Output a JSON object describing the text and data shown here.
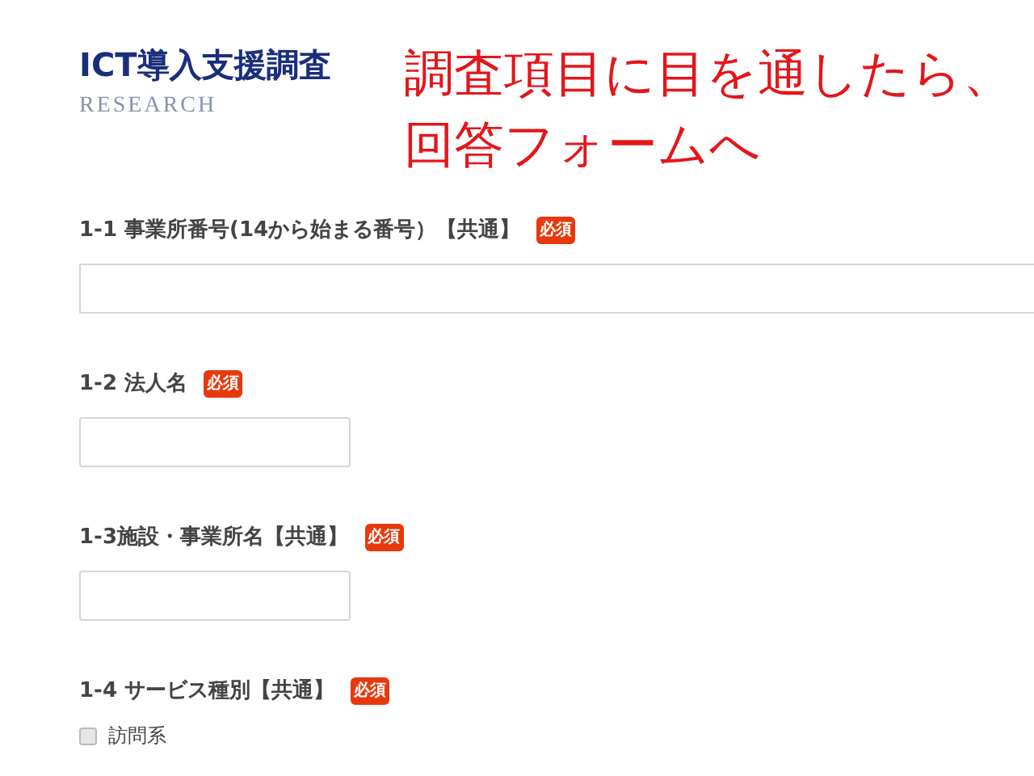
{
  "brand": {
    "title": "ICT導入支援調査",
    "subtitle": "RESEARCH"
  },
  "annotation": {
    "lines": [
      "調査項目に目を通したら、",
      "回答フォームへ"
    ]
  },
  "questions": [
    {
      "kind": "text-wide",
      "label": "1-1 事業所番号(14から始まる番号）【共通】",
      "badge": "必須"
    },
    {
      "kind": "text",
      "label": "1-2 法人名",
      "badge": "必須"
    },
    {
      "kind": "text",
      "label": "1-3施設・事業所名【共通】",
      "badge": "必須"
    },
    {
      "kind": "checkboxes",
      "label": "1-4 サービス種別【共通】",
      "badge": "必須",
      "options": [
        {
          "label": "訪問系",
          "checked": false
        }
      ]
    }
  ]
}
